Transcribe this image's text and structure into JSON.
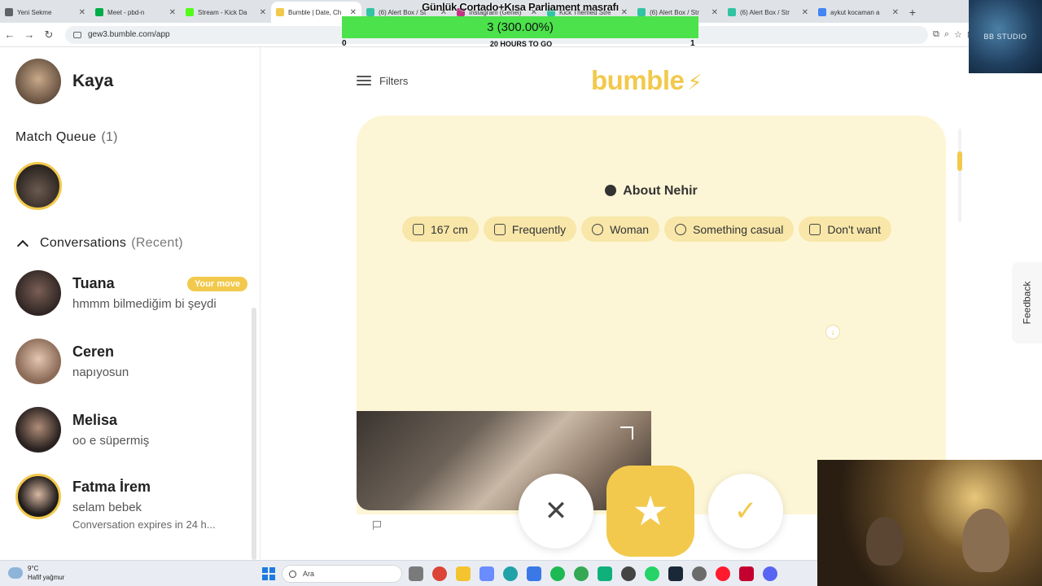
{
  "browser": {
    "tabs": [
      {
        "label": "Yeni Sekme",
        "color": "#5f6368"
      },
      {
        "label": "Meet - pbd-n",
        "color": "#00ac47"
      },
      {
        "label": "Stream - Kick Da",
        "color": "#53fc18"
      },
      {
        "label": "Bumble | Date, Ch",
        "color": "#f2c94c"
      },
      {
        "label": "(6) Alert Box / St",
        "color": "#31c3a2"
      },
      {
        "label": "Instagram (Genel)",
        "color": "#c13584"
      },
      {
        "label": "Kick Themed Stre",
        "color": "#31c3a2"
      },
      {
        "label": "(6) Alert Box / Str",
        "color": "#31c3a2"
      },
      {
        "label": "(6) Alert Box / Str",
        "color": "#31c3a2"
      },
      {
        "label": "aykut kocaman a",
        "color": "#4285f4"
      }
    ],
    "new_tab": "+",
    "url": "gew3.bumble.com/app"
  },
  "stream_goal": {
    "title": "Günlük Cortado+Kısa Parliament masrafı",
    "progress_text": "3 (300.00%)",
    "progress_fraction": 1.0,
    "min": "0",
    "time_left": "20 HOURS TO GO",
    "max": "1",
    "bar_color": "#4be24b"
  },
  "studio_label": "BB STUDIO",
  "profile": {
    "name": "Kaya"
  },
  "match_queue": {
    "label": "Match Queue",
    "count": "(1)"
  },
  "conversations": {
    "label": "Conversations",
    "sub": "(Recent)",
    "items": [
      {
        "name": "Tuana",
        "message": "hmmm bilmediğim bi şeydi",
        "badge": "Your move"
      },
      {
        "name": "Ceren",
        "message": "napıyosun"
      },
      {
        "name": "Melisa",
        "message": "oo e süpermiş"
      },
      {
        "name": "Fatma İrem",
        "message": "selam bebek",
        "expiry": "Conversation expires in 24 h..."
      }
    ]
  },
  "main": {
    "filters_label": "Filters",
    "logo": "bumble",
    "about_title": "About Nehir",
    "chips": [
      {
        "label": "167 cm",
        "icon": "ruler-icon"
      },
      {
        "label": "Frequently",
        "icon": "drink-icon"
      },
      {
        "label": "Woman",
        "icon": "gender-icon"
      },
      {
        "label": "Something casual",
        "icon": "magnifier-icon"
      },
      {
        "label": "Don't want",
        "icon": "baby-icon"
      }
    ],
    "feedback_label": "Feedback",
    "actions": {
      "pass": "✕",
      "superswipe": "★",
      "like": "✓"
    }
  },
  "taskbar": {
    "weather_temp": "9°C",
    "weather_desc": "Hafif yağmur",
    "search_placeholder": "Ara"
  },
  "colors": {
    "accent": "#f2c94c",
    "card_bg": "#fdf6d6",
    "chip_bg": "#f8e7a9"
  }
}
